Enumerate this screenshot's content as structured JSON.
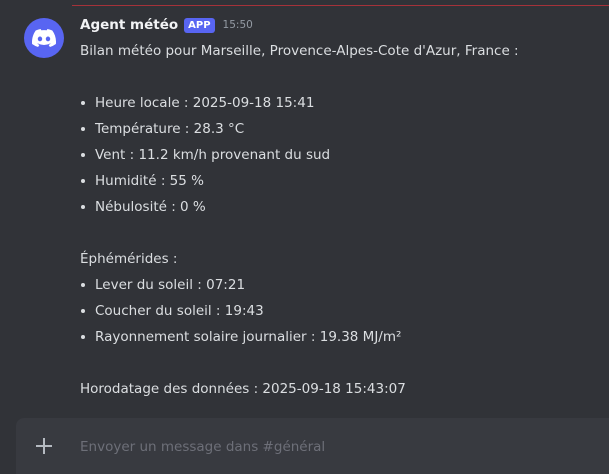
{
  "message": {
    "author": "Agent météo",
    "badge": "APP",
    "timestamp": "15:50",
    "intro": "Bilan météo pour Marseille, Provence-Alpes-Cote d'Azur, France :",
    "weather_items": [
      "Heure locale : 2025-09-18 15:41",
      "Température : 28.3 °C",
      "Vent : 11.2 km/h provenant du sud",
      "Humidité : 55 %",
      "Nébulosité : 0 %"
    ],
    "ephemeris_title": "Éphémérides :",
    "ephemeris_items": [
      "Lever du soleil : 07:21",
      "Coucher du soleil : 19:43",
      "Rayonnement solaire journalier : 19.38 MJ/m²"
    ],
    "data_timestamp": "Horodatage des données : 2025-09-18 15:43:07"
  },
  "composer": {
    "placeholder": "Envoyer un message dans #général"
  },
  "icons": {
    "avatar": "discord-logo-icon",
    "composer_add": "plus-icon"
  },
  "colors": {
    "background": "#313338",
    "accent": "#5865f2",
    "composer_bg": "#383a40"
  }
}
